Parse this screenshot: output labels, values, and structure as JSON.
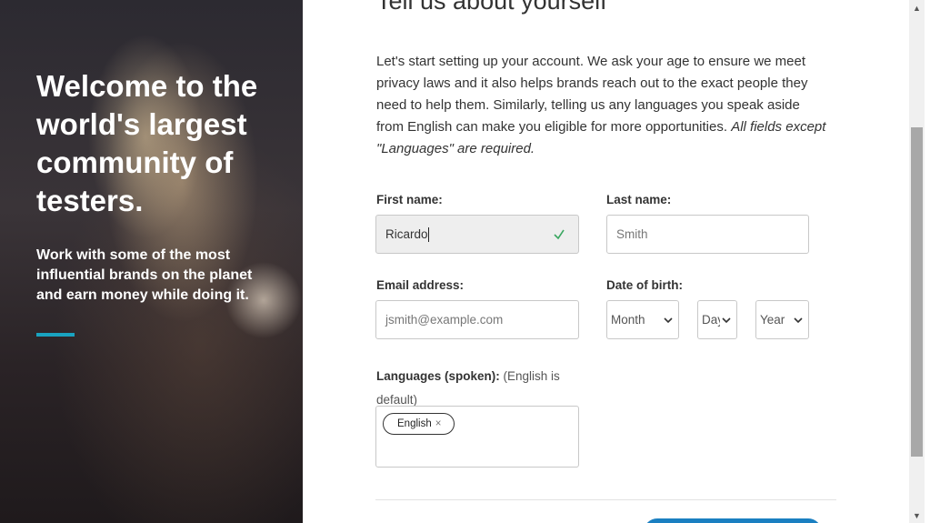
{
  "hero": {
    "title": "Welcome to the world's largest community of testers.",
    "subtitle": "Work with some of the most influential brands on the planet and earn money while doing it.",
    "accent_color": "#19a3c0"
  },
  "form": {
    "title": "Tell us about yourself",
    "intro": "Let's start setting up your account. We ask your age to ensure we meet privacy laws and it also helps brands reach out to the exact people they need to help them. Similarly, telling us any languages you speak aside from English can make you eligible for more opportunities.",
    "intro_note": "All fields except \"Languages\" are required.",
    "first_name": {
      "label": "First name:",
      "value": "Ricardo",
      "valid_icon": "check-icon"
    },
    "last_name": {
      "label": "Last name:",
      "placeholder": "Smith"
    },
    "email": {
      "label": "Email address:",
      "placeholder": "jsmith@example.com"
    },
    "dob": {
      "label": "Date of birth:",
      "month": "Month",
      "day": "Day",
      "year": "Year"
    },
    "languages": {
      "label": "Languages (spoken):",
      "note": "(English is default)",
      "tags": [
        {
          "label": "English",
          "remove": "×"
        }
      ]
    },
    "primary_color": "#1a7fc1"
  }
}
